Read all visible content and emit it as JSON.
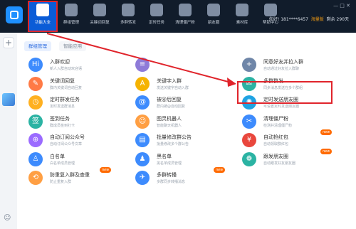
{
  "toolbar": {
    "items": [
      {
        "label": "功能大全",
        "icon": "grid-icon",
        "active": true
      },
      {
        "label": "群组管理",
        "icon": "layers-icon"
      },
      {
        "label": "关键词回复",
        "icon": "text-icon"
      },
      {
        "label": "多群转发",
        "icon": "users-icon"
      },
      {
        "label": "定时任务",
        "icon": "calendar-icon"
      },
      {
        "label": "清理僵尸粉",
        "icon": "broom-icon"
      },
      {
        "label": "朋友圈",
        "icon": "camera-icon"
      },
      {
        "label": "素材库",
        "icon": "folder-icon"
      },
      {
        "label": "帮助中心",
        "icon": "help-icon"
      }
    ],
    "user_name": "你好! 181****6457",
    "member_label": "海量版",
    "member_price": "剩余 290天"
  },
  "tabs": [
    {
      "label": "群组管理",
      "active": true
    },
    {
      "label": "智能应用",
      "active": false
    }
  ],
  "sidebar": {
    "add_label": "+"
  },
  "features": [
    {
      "title": "入群欢迎",
      "desc": "新人入群自动欢迎语",
      "color": "#3d8bfd",
      "glyph": "Hi",
      "badge": ""
    },
    {
      "title": "",
      "desc": "",
      "color": "#8e7bd8",
      "glyph": "≡",
      "badge": ""
    },
    {
      "title": "同意好友并拉入群",
      "desc": "自动通过好友拉入群聊",
      "color": "#6f86a8",
      "glyph": "+",
      "badge": ""
    },
    {
      "title": "关键词回复",
      "desc": "群内关键词自动回复",
      "color": "#ff7a45",
      "glyph": "✎",
      "badge": ""
    },
    {
      "title": "关键字入群",
      "desc": "发送关键字自动入群",
      "color": "#f5b301",
      "glyph": "A",
      "badge": ""
    },
    {
      "title": "多群群发",
      "desc": "同步消息发送在多个群组",
      "color": "#2bb3a3",
      "glyph": "✉",
      "badge": ""
    },
    {
      "title": "定时群发任务",
      "desc": "定时发送群消息",
      "color": "#ffb020",
      "glyph": "◷",
      "badge": ""
    },
    {
      "title": "被@后回复",
      "desc": "群内被@自动回复",
      "color": "#3d8bfd",
      "glyph": "@",
      "badge": ""
    },
    {
      "title": "定时发送朋友圈",
      "desc": "可设置定时发送朋友圈",
      "color": "#1fa3e3",
      "glyph": "✺",
      "badge": ""
    },
    {
      "title": "签到任务",
      "desc": "群成员签到打卡",
      "color": "#2bb3a3",
      "glyph": "签",
      "badge": ""
    },
    {
      "title": "图灵机器人",
      "desc": "智能聊天机器人",
      "color": "#ff9f43",
      "glyph": "☺",
      "badge": ""
    },
    {
      "title": "清理僵尸粉",
      "desc": "检测并清理僵尸粉",
      "color": "#3d8bfd",
      "glyph": "✂",
      "badge": ""
    },
    {
      "title": "自动订阅公众号",
      "desc": "自动订阅公众号文章",
      "color": "#9b6bff",
      "glyph": "⊕",
      "badge": ""
    },
    {
      "title": "批量修改群公告",
      "desc": "批量修改多个群公告",
      "color": "#3d8bfd",
      "glyph": "▤",
      "badge": ""
    },
    {
      "title": "自动抢红包",
      "desc": "自动领取群红包",
      "color": "#e9473d",
      "glyph": "¥",
      "badge": "new"
    },
    {
      "title": "白名单",
      "desc": "白名单成员管理",
      "color": "#3d8bfd",
      "glyph": "♙",
      "badge": ""
    },
    {
      "title": "黑名单",
      "desc": "黑名单成员管理",
      "color": "#3d8bfd",
      "glyph": "♟",
      "badge": ""
    },
    {
      "title": "跟发朋友圈",
      "desc": "自动跟发好友朋友圈",
      "color": "#2bb3a3",
      "glyph": "❁",
      "badge": "new"
    },
    {
      "title": "防重复入群及查重",
      "desc": "防止重复入群",
      "color": "#ff9f43",
      "glyph": "⟲",
      "badge": "new"
    },
    {
      "title": "多群转播",
      "desc": "多群同步转播消息",
      "color": "#3d8bfd",
      "glyph": "✈",
      "badge": "new"
    },
    {
      "title": "",
      "desc": "",
      "color": "#ffffff",
      "glyph": "",
      "badge": ""
    }
  ],
  "colors": {
    "accent": "#0b5cd7",
    "annotation": "#e0242b",
    "topbar": "#111c2b"
  }
}
